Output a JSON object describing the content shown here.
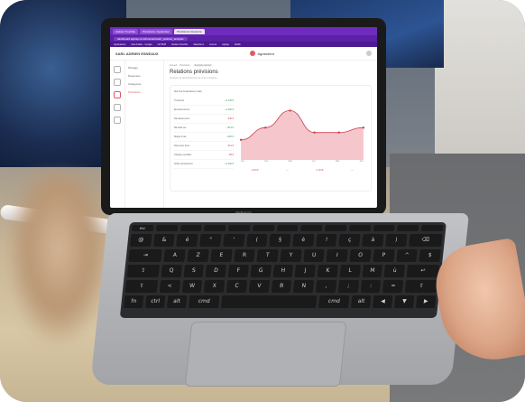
{
  "laptop": {
    "label": "MacBook Pro",
    "browser": {
      "tabs": [
        "Ateliers Touchfie",
        "Prévisions / Agrandeur",
        "Prévisions trésorerie"
      ],
      "url": "dashboard.agicap.com/forecast/cash_position_analysis",
      "bookmarks": [
        "Applications",
        "New Folder - Google",
        "GITHUB",
        "Ateliers Touchfie",
        "Salesforce",
        "Access",
        "Agicap",
        "Netflix"
      ]
    },
    "app": {
      "company": "SARL ADRIEN ESNEAUX",
      "brand": "Agrandeur",
      "side_menu": [
        "Pilotage",
        "Dépenses",
        "Catégories",
        "Prévisions"
      ],
      "breadcrumbs": [
        "Accueil",
        "Prévisions",
        "Scénario Janvier"
      ],
      "page_title": "Relations prévisions",
      "page_subtitle": "Anticipez la santé financière de votre entreprise",
      "card_title": "Sur les 6 derniers mois",
      "metrics": [
        {
          "label": "Trésorerie",
          "value": "+2 345 €",
          "negative": false
        },
        {
          "label": "Encaissements",
          "value": "+1 460 €",
          "negative": false
        },
        {
          "label": "Décaissements",
          "value": "-946 €",
          "negative": true
        },
        {
          "label": "Résultat net",
          "value": "+514 €",
          "negative": false
        },
        {
          "label": "Marge brute",
          "value": "+320 €",
          "negative": false
        },
        {
          "label": "Dépenses fixes",
          "value": "-212 €",
          "negative": true
        },
        {
          "label": "Charges sociales",
          "value": "-98 €",
          "negative": true
        },
        {
          "label": "Solde prévisionnel",
          "value": "+1 032 €",
          "negative": false
        }
      ],
      "chart_months": [
        "Jan",
        "Fév",
        "Mar",
        "Avr",
        "Mai",
        "Juin"
      ],
      "chart_values": [
        0.3,
        0.55,
        0.9,
        0.45,
        0.45,
        0.55
      ],
      "legend_values": [
        "1 234 €",
        "—",
        "2 110 €",
        "—"
      ]
    }
  },
  "colors": {
    "browser_chrome": "#6f2bbd",
    "accent": "#e05a6a",
    "positive": "#2e9b4f",
    "negative": "#d0404f"
  }
}
